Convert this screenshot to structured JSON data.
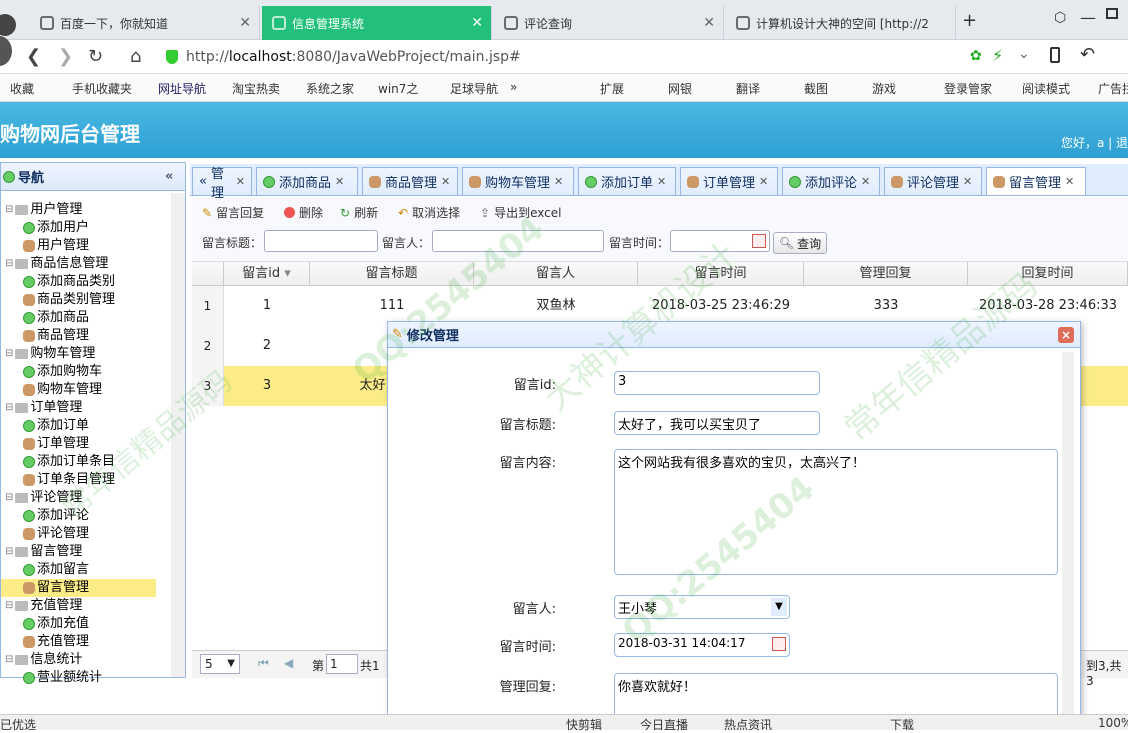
{
  "browser": {
    "tabs": [
      {
        "label": "百度一下，你就知道",
        "active": false
      },
      {
        "label": "信息管理系统",
        "active": true
      },
      {
        "label": "评论查询",
        "active": false
      },
      {
        "label": "计算机设计大神的空间 [http://2",
        "active": false
      }
    ],
    "new_tab": "+",
    "url_scheme": "http://",
    "url_host": "localhost",
    "url_path": ":8080/JavaWebProject/main.jsp#",
    "accent": "#22c07a"
  },
  "bookmarks": [
    "收藏",
    "手机收藏夹",
    "网址导航",
    "淘宝热卖",
    "系统之家",
    "win7之",
    "足球导航",
    "»"
  ],
  "bookmarks_right": [
    "扩展",
    "网银",
    "翻译",
    "截图",
    "游戏",
    "登录管家",
    "阅读模式",
    "广告拦"
  ],
  "app": {
    "title": "购物网后台管理",
    "greeting": "您好，a | 退"
  },
  "sidebar": {
    "title": "导航",
    "collapse": "«",
    "tree": [
      {
        "label": "用户管理",
        "level": 0,
        "icon": "folder"
      },
      {
        "label": "添加用户",
        "level": 1,
        "icon": "add"
      },
      {
        "label": "用户管理",
        "level": 1,
        "icon": "user"
      },
      {
        "label": "商品信息管理",
        "level": 0,
        "icon": "folder"
      },
      {
        "label": "添加商品类别",
        "level": 1,
        "icon": "add"
      },
      {
        "label": "商品类别管理",
        "level": 1,
        "icon": "user"
      },
      {
        "label": "添加商品",
        "level": 1,
        "icon": "add"
      },
      {
        "label": "商品管理",
        "level": 1,
        "icon": "user"
      },
      {
        "label": "购物车管理",
        "level": 0,
        "icon": "folder"
      },
      {
        "label": "添加购物车",
        "level": 1,
        "icon": "add"
      },
      {
        "label": "购物车管理",
        "level": 1,
        "icon": "user"
      },
      {
        "label": "订单管理",
        "level": 0,
        "icon": "folder"
      },
      {
        "label": "添加订单",
        "level": 1,
        "icon": "add"
      },
      {
        "label": "订单管理",
        "level": 1,
        "icon": "user"
      },
      {
        "label": "添加订单条目",
        "level": 1,
        "icon": "add"
      },
      {
        "label": "订单条目管理",
        "level": 1,
        "icon": "user"
      },
      {
        "label": "评论管理",
        "level": 0,
        "icon": "folder"
      },
      {
        "label": "添加评论",
        "level": 1,
        "icon": "add"
      },
      {
        "label": "评论管理",
        "level": 1,
        "icon": "user"
      },
      {
        "label": "留言管理",
        "level": 0,
        "icon": "folder"
      },
      {
        "label": "添加留言",
        "level": 1,
        "icon": "add"
      },
      {
        "label": "留言管理",
        "level": 1,
        "icon": "user",
        "selected": true
      },
      {
        "label": "充值管理",
        "level": 0,
        "icon": "folder"
      },
      {
        "label": "添加充值",
        "level": 1,
        "icon": "add"
      },
      {
        "label": "充值管理",
        "level": 1,
        "icon": "user"
      },
      {
        "label": "信息统计",
        "level": 0,
        "icon": "folder"
      },
      {
        "label": "营业额统计",
        "level": 1,
        "icon": "add"
      }
    ]
  },
  "main_tabs": [
    {
      "label": "管理",
      "icon": "«"
    },
    {
      "label": "添加商品",
      "icon": "add"
    },
    {
      "label": "商品管理",
      "icon": "user"
    },
    {
      "label": "购物车管理",
      "icon": "user"
    },
    {
      "label": "添加订单",
      "icon": "add"
    },
    {
      "label": "订单管理",
      "icon": "user"
    },
    {
      "label": "添加评论",
      "icon": "add"
    },
    {
      "label": "评论管理",
      "icon": "user"
    },
    {
      "label": "留言管理",
      "icon": "user",
      "active": true
    }
  ],
  "toolbar": {
    "reply": "留言回复",
    "delete": "删除",
    "refresh": "刷新",
    "cancel_select": "取消选择",
    "export": "导出到excel",
    "search_title_label": "留言标题：",
    "search_person_label": "留言人：",
    "search_time_label": "留言时间：",
    "query": "查询"
  },
  "grid": {
    "columns": [
      "留言id",
      "留言标题",
      "留言人",
      "留言时间",
      "管理回复",
      "回复时间"
    ],
    "rows": [
      {
        "rownum": "1",
        "id": "1",
        "title": "111",
        "person": "双鱼林",
        "time": "2018-03-25 23:46:29",
        "reply": "333",
        "reply_time": "2018-03-28 23:46:33"
      },
      {
        "rownum": "2",
        "id": "2",
        "title": "",
        "person": "",
        "time": "",
        "reply": "",
        "reply_time": "28:01"
      },
      {
        "rownum": "3",
        "id": "3",
        "title": "太好了，我",
        "person": "",
        "time": "",
        "reply": "",
        "reply_time": "09:07",
        "selected": true
      }
    ]
  },
  "pager": {
    "page_size": "5",
    "page_label": "第",
    "page_value": "1",
    "total_prefix": "共1",
    "summary": "到3,共3"
  },
  "dialog": {
    "title": "修改管理",
    "close": "×",
    "fields": {
      "id_label": "留言id:",
      "id_value": "3",
      "title_label": "留言标题:",
      "title_value": "太好了，我可以买宝贝了",
      "content_label": "留言内容:",
      "content_value": "这个网站我有很多喜欢的宝贝，太高兴了！",
      "person_label": "留言人:",
      "person_value": "王小琴",
      "time_label": "留言时间:",
      "time_value": "2018-03-31 14:04:17",
      "reply_label": "管理回复:",
      "reply_value": "你喜欢就好！"
    }
  },
  "statusbar": {
    "left": "已优选",
    "items": [
      "快剪辑",
      "今日直播",
      "热点资讯",
      "下载",
      "100%"
    ]
  },
  "watermark": {
    "qq": "QQ:2545404",
    "text1": "常年信精品源码",
    "text2": "大神计算机设计"
  }
}
